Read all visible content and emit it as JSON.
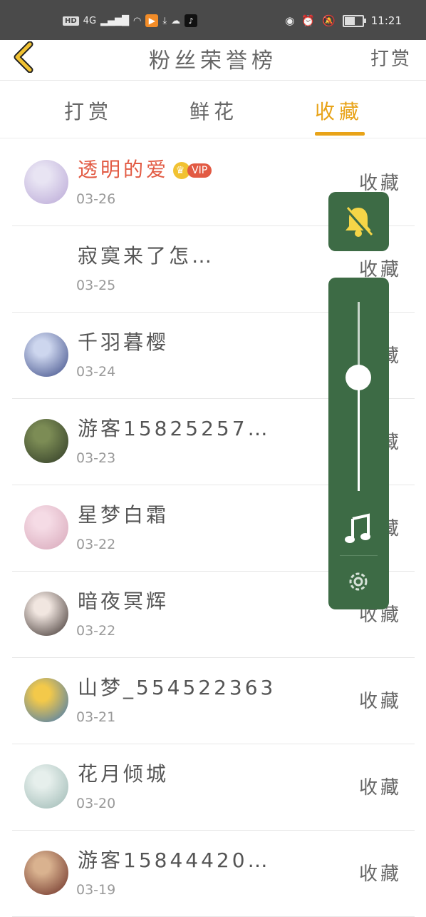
{
  "statusbar": {
    "hd": "HD",
    "signal": "4G",
    "time": "11:21"
  },
  "header": {
    "title": "粉丝荣誉榜",
    "right_action": "打赏"
  },
  "tabs": [
    {
      "label": "打赏",
      "active": false
    },
    {
      "label": "鲜花",
      "active": false
    },
    {
      "label": "收藏",
      "active": true
    }
  ],
  "accent_color": "#e8a318",
  "vip_badge": "VIP",
  "rows": [
    {
      "name": "透明的爱",
      "date": "03-26",
      "action": "收藏",
      "vip": true,
      "avatar_colors": [
        "#e8e4f3",
        "#b9a7d6"
      ]
    },
    {
      "name": "寂寞来了怎…",
      "date": "03-25",
      "action": "收藏",
      "vip": false,
      "avatar_colors": [
        "#ffffff",
        "#ffffff"
      ]
    },
    {
      "name": "千羽暮樱",
      "date": "03-24",
      "action": "收藏",
      "vip": false,
      "avatar_colors": [
        "#cdd6ee",
        "#3c4b86"
      ]
    },
    {
      "name": "游客15825257…",
      "date": "03-23",
      "action": "收藏",
      "vip": false,
      "avatar_colors": [
        "#7c8c55",
        "#2f3a26"
      ]
    },
    {
      "name": "星梦白霜",
      "date": "03-22",
      "action": "收藏",
      "vip": false,
      "avatar_colors": [
        "#f5dbe5",
        "#d7a7b9"
      ]
    },
    {
      "name": "暗夜冥辉",
      "date": "03-22",
      "action": "收藏",
      "vip": false,
      "avatar_colors": [
        "#f1e6e0",
        "#3a2f2c"
      ]
    },
    {
      "name": "山梦_554522363",
      "date": "03-21",
      "action": "收藏",
      "vip": false,
      "avatar_colors": [
        "#f3c94a",
        "#3c76b8"
      ]
    },
    {
      "name": "花月倾城",
      "date": "03-20",
      "action": "收藏",
      "vip": false,
      "avatar_colors": [
        "#e6efec",
        "#9cb8b3"
      ]
    },
    {
      "name": "游客15844420…",
      "date": "03-19",
      "action": "收藏",
      "vip": false,
      "avatar_colors": [
        "#d9b28f",
        "#6a2d24"
      ]
    }
  ],
  "overlay": {
    "bell_icon": "bell-muted-icon",
    "music_icon": "music-note-icon",
    "settings_icon": "gear-icon",
    "volume_level": 0.6,
    "panel_color": "#3d6b45",
    "bell_color": "#f5d547"
  }
}
